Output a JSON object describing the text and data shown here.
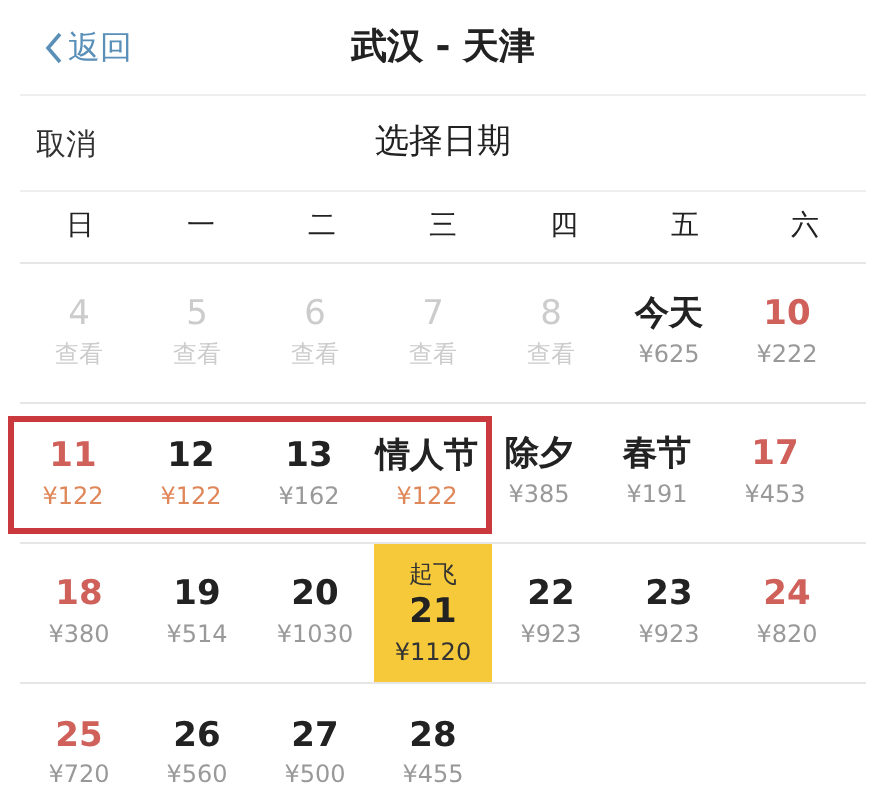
{
  "nav": {
    "back": "返回",
    "title": "武汉 - 天津"
  },
  "picker": {
    "cancel": "取消",
    "title": "选择日期"
  },
  "weekdays": [
    {
      "label": "日",
      "weekend": false
    },
    {
      "label": "一",
      "weekend": false
    },
    {
      "label": "二",
      "weekend": false
    },
    {
      "label": "三",
      "weekend": false
    },
    {
      "label": "四",
      "weekend": false
    },
    {
      "label": "五",
      "weekend": false
    },
    {
      "label": "六",
      "weekend": false
    }
  ],
  "weeks": [
    [
      {
        "day": "4",
        "price": "查看",
        "kind": "disabled",
        "cheap": false,
        "boxed": false,
        "selected": false
      },
      {
        "day": "5",
        "price": "查看",
        "kind": "disabled",
        "cheap": false,
        "boxed": false,
        "selected": false
      },
      {
        "day": "6",
        "price": "查看",
        "kind": "disabled",
        "cheap": false,
        "boxed": false,
        "selected": false
      },
      {
        "day": "7",
        "price": "查看",
        "kind": "disabled",
        "cheap": false,
        "boxed": false,
        "selected": false
      },
      {
        "day": "8",
        "price": "查看",
        "kind": "disabled",
        "cheap": false,
        "boxed": false,
        "selected": false
      },
      {
        "day": "今天",
        "price": "¥625",
        "kind": "normal",
        "cheap": false,
        "boxed": false,
        "selected": false
      },
      {
        "day": "10",
        "price": "¥222",
        "kind": "weekend",
        "cheap": false,
        "boxed": false,
        "selected": false
      }
    ],
    [
      {
        "day": "11",
        "price": "¥122",
        "kind": "weekend",
        "cheap": true,
        "boxed": true,
        "selected": false
      },
      {
        "day": "12",
        "price": "¥122",
        "kind": "normal",
        "cheap": true,
        "boxed": true,
        "selected": false
      },
      {
        "day": "13",
        "price": "¥162",
        "kind": "normal",
        "cheap": false,
        "boxed": true,
        "selected": false
      },
      {
        "day": "情人节",
        "price": "¥122",
        "kind": "normal",
        "cheap": true,
        "boxed": true,
        "selected": false
      },
      {
        "day": "除夕",
        "price": "¥385",
        "kind": "normal",
        "cheap": false,
        "boxed": false,
        "selected": false
      },
      {
        "day": "春节",
        "price": "¥191",
        "kind": "normal",
        "cheap": false,
        "boxed": false,
        "selected": false
      },
      {
        "day": "17",
        "price": "¥453",
        "kind": "weekend",
        "cheap": false,
        "boxed": false,
        "selected": false
      }
    ],
    [
      {
        "day": "18",
        "price": "¥380",
        "kind": "weekend",
        "cheap": false,
        "boxed": false,
        "selected": false
      },
      {
        "day": "19",
        "price": "¥514",
        "kind": "normal",
        "cheap": false,
        "boxed": false,
        "selected": false
      },
      {
        "day": "20",
        "price": "¥1030",
        "kind": "normal",
        "cheap": false,
        "boxed": false,
        "selected": false
      },
      {
        "day": "21",
        "price": "¥1120",
        "kind": "normal",
        "cheap": false,
        "boxed": false,
        "selected": true,
        "tag": "起飞"
      },
      {
        "day": "22",
        "price": "¥923",
        "kind": "normal",
        "cheap": false,
        "boxed": false,
        "selected": false
      },
      {
        "day": "23",
        "price": "¥923",
        "kind": "normal",
        "cheap": false,
        "boxed": false,
        "selected": false
      },
      {
        "day": "24",
        "price": "¥820",
        "kind": "weekend",
        "cheap": false,
        "boxed": false,
        "selected": false
      }
    ],
    [
      {
        "day": "25",
        "price": "¥720",
        "kind": "weekend",
        "cheap": false,
        "boxed": false,
        "selected": false
      },
      {
        "day": "26",
        "price": "¥560",
        "kind": "normal",
        "cheap": false,
        "boxed": false,
        "selected": false
      },
      {
        "day": "27",
        "price": "¥500",
        "kind": "normal",
        "cheap": false,
        "boxed": false,
        "selected": false
      },
      {
        "day": "28",
        "price": "¥455",
        "kind": "normal",
        "cheap": false,
        "boxed": false,
        "selected": false
      }
    ]
  ]
}
